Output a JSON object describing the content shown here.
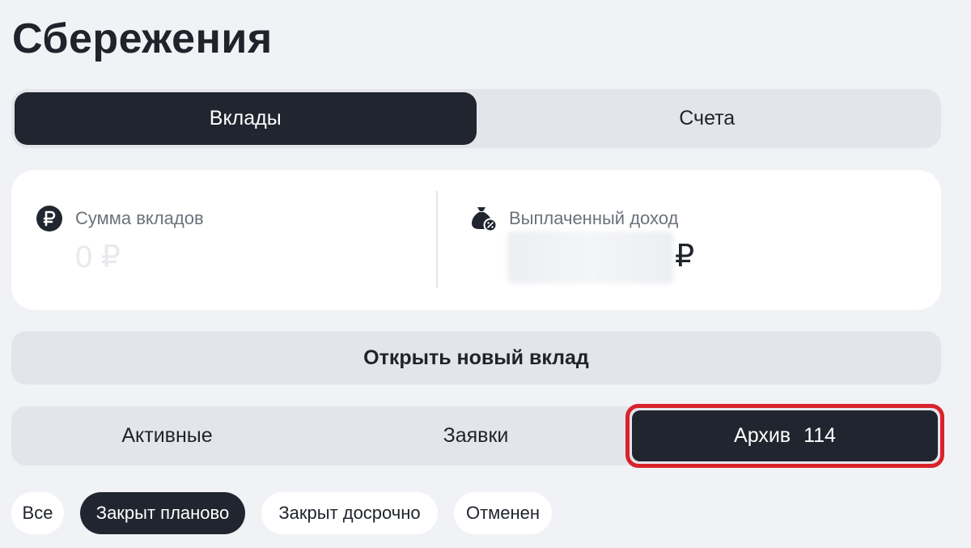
{
  "page": {
    "title": "Сбережения"
  },
  "top_tabs": {
    "deposits": "Вклады",
    "accounts": "Счета"
  },
  "summary": {
    "deposits_sum_label": "Сумма вкладов",
    "deposits_sum_value": "0 ₽",
    "paid_income_label": "Выплаченный доход",
    "paid_income_currency": "₽"
  },
  "actions": {
    "open_new_deposit": "Открыть новый вклад"
  },
  "status_tabs": {
    "active": "Активные",
    "requests": "Заявки",
    "archive": "Архив",
    "archive_count": "114"
  },
  "filters": {
    "all": "Все",
    "closed_planned": "Закрыт планово",
    "closed_early": "Закрыт досрочно",
    "cancelled": "Отменен"
  },
  "colors": {
    "dark": "#21252f",
    "highlight": "#d9232a",
    "background": "#f1f2f6"
  },
  "icons": {
    "deposits_sum": "ruble-coin-icon",
    "paid_income": "money-bag-percent-icon"
  }
}
